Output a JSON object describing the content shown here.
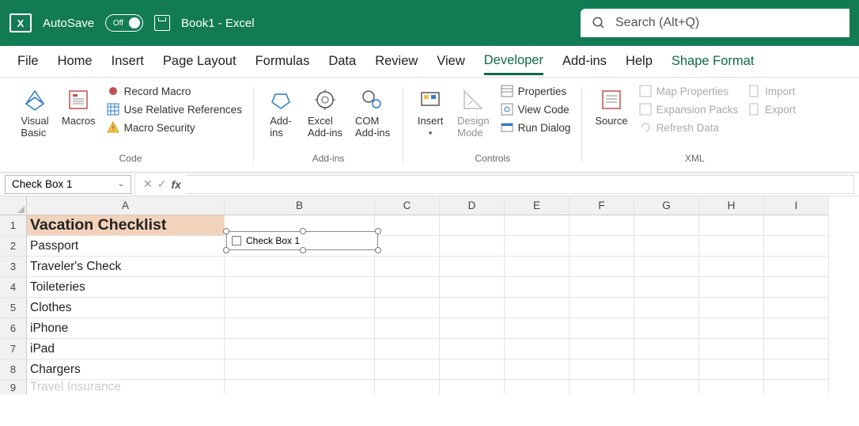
{
  "titlebar": {
    "autosave_label": "AutoSave",
    "toggle_state": "Off",
    "document": "Book1",
    "app_suffix": "  -  Excel",
    "search_placeholder": "Search (Alt+Q)"
  },
  "tabs": [
    "File",
    "Home",
    "Insert",
    "Page Layout",
    "Formulas",
    "Data",
    "Review",
    "View",
    "Developer",
    "Add-ins",
    "Help",
    "Shape Format"
  ],
  "active_tab_index": 8,
  "special_tab_index": 11,
  "ribbon": {
    "groups": {
      "code": {
        "label": "Code",
        "visual_basic": "Visual\nBasic",
        "macros": "Macros",
        "record_macro": "Record Macro",
        "use_relative": "Use Relative References",
        "macro_security": "Macro Security"
      },
      "addins": {
        "label": "Add-ins",
        "addins": "Add-\nins",
        "excel_addins": "Excel\nAdd-ins",
        "com_addins": "COM\nAdd-ins"
      },
      "controls": {
        "label": "Controls",
        "insert": "Insert",
        "design_mode": "Design\nMode",
        "properties": "Properties",
        "view_code": "View Code",
        "run_dialog": "Run Dialog"
      },
      "xml": {
        "label": "XML",
        "source": "Source",
        "map_properties": "Map Properties",
        "expansion_packs": "Expansion Packs",
        "refresh_data": "Refresh Data",
        "import": "Import",
        "export": "Export"
      }
    }
  },
  "namebox": "Check Box 1",
  "columns": [
    "A",
    "B",
    "C",
    "D",
    "E",
    "F",
    "G",
    "H",
    "I"
  ],
  "rows": [
    1,
    2,
    3,
    4,
    5,
    6,
    7,
    8,
    9
  ],
  "cells": {
    "A1": "Vacation Checklist",
    "A2": "Passport",
    "A3": "Traveler's Check",
    "A4": "Toileteries",
    "A5": "Clothes",
    "A6": "iPhone",
    "A7": "iPad",
    "A8": "Chargers",
    "A9": "Travel Insurance"
  },
  "shape": {
    "label": "Check Box 1"
  }
}
